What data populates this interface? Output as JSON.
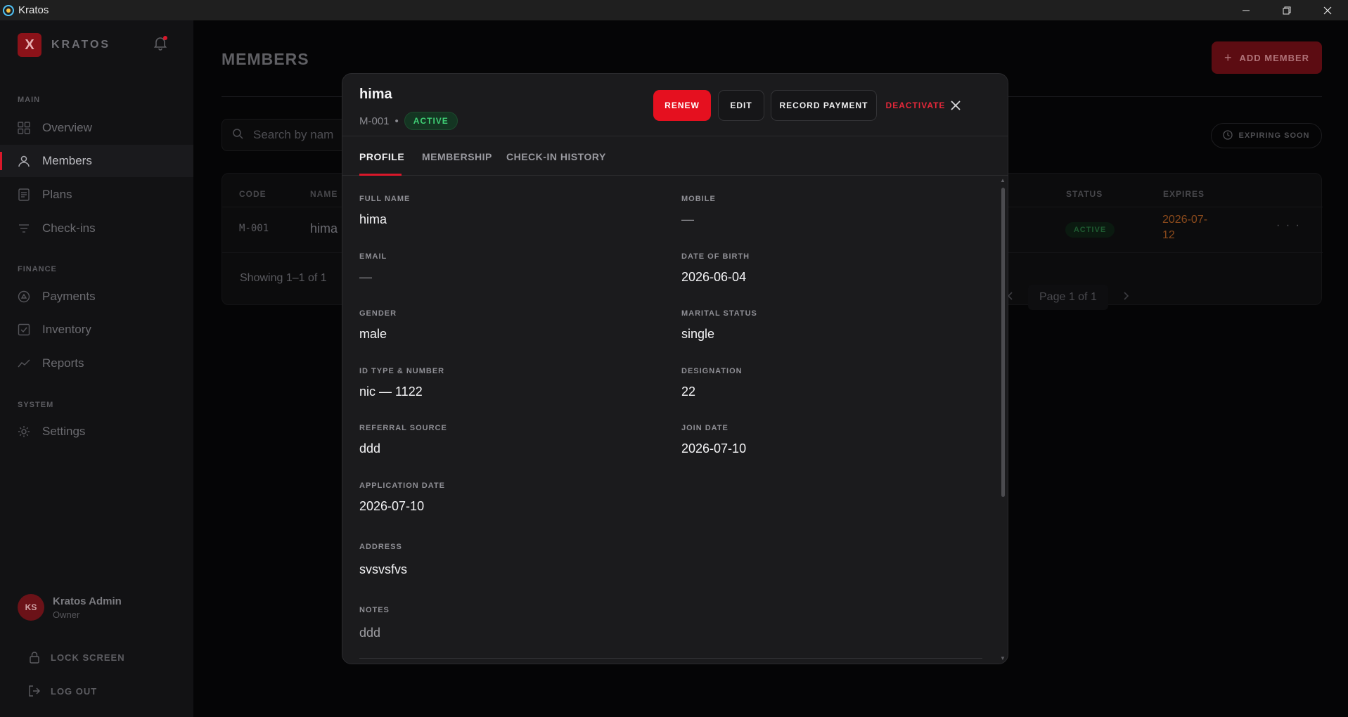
{
  "window": {
    "title": "Kratos",
    "controls": [
      "minimize",
      "restore",
      "close"
    ]
  },
  "sidebar": {
    "brand": {
      "logo_letter": "X",
      "name": "KRATOS"
    },
    "sections": [
      {
        "label": "MAIN",
        "items": [
          {
            "label": "Overview",
            "icon": "grid-icon",
            "active": false
          },
          {
            "label": "Members",
            "icon": "user-icon",
            "active": true
          },
          {
            "label": "Plans",
            "icon": "document-icon",
            "active": false
          },
          {
            "label": "Check-ins",
            "icon": "filter-icon",
            "active": false
          }
        ]
      },
      {
        "label": "FINANCE",
        "items": [
          {
            "label": "Payments",
            "icon": "coin-icon",
            "active": false
          },
          {
            "label": "Inventory",
            "icon": "checkbox-icon",
            "active": false
          },
          {
            "label": "Reports",
            "icon": "trend-icon",
            "active": false
          }
        ]
      },
      {
        "label": "SYSTEM",
        "items": [
          {
            "label": "Settings",
            "icon": "gear-icon",
            "active": false
          }
        ]
      }
    ],
    "user": {
      "initials": "KS",
      "name": "Kratos Admin",
      "role": "Owner"
    },
    "lock_label": "LOCK SCREEN",
    "logout_label": "LOG OUT"
  },
  "main": {
    "title": "MEMBERS",
    "add_button": "ADD MEMBER",
    "search_placeholder": "Search by nam",
    "expiring_filter": "EXPIRING SOON",
    "table": {
      "headers": {
        "code": "CODE",
        "name": "NAME",
        "status": "STATUS",
        "expires": "EXPIRES"
      },
      "rows": [
        {
          "code": "M-001",
          "name": "hima",
          "status": "ACTIVE",
          "expires_line1": "2026-07-",
          "expires_line2": "12",
          "menu": "· · ·"
        }
      ],
      "showing": "Showing 1–1 of 1",
      "page_label": "Page 1 of 1"
    }
  },
  "modal": {
    "name": "hima",
    "code": "M-001",
    "status": "ACTIVE",
    "actions": {
      "renew": "RENEW",
      "edit": "EDIT",
      "record_payment": "RECORD PAYMENT",
      "deactivate": "DEACTIVATE"
    },
    "tabs": [
      "PROFILE",
      "MEMBERSHIP",
      "CHECK-IN HISTORY"
    ],
    "active_tab": "PROFILE",
    "fields": {
      "full_name": {
        "label": "FULL NAME",
        "value": "hima"
      },
      "mobile": {
        "label": "MOBILE",
        "value": "—"
      },
      "email": {
        "label": "EMAIL",
        "value": "—"
      },
      "dob": {
        "label": "DATE OF BIRTH",
        "value": "2026-06-04"
      },
      "gender": {
        "label": "GENDER",
        "value": "male"
      },
      "marital": {
        "label": "MARITAL STATUS",
        "value": "single"
      },
      "id_type": {
        "label": "ID TYPE & NUMBER",
        "value": "nic — 1122"
      },
      "designation": {
        "label": "DESIGNATION",
        "value": "22"
      },
      "referral": {
        "label": "REFERRAL SOURCE",
        "value": "ddd"
      },
      "join_date": {
        "label": "JOIN DATE",
        "value": "2026-07-10"
      },
      "application_date": {
        "label": "APPLICATION DATE",
        "value": "2026-07-10"
      },
      "address": {
        "label": "ADDRESS",
        "value": "svsvsfvs"
      },
      "notes": {
        "label": "NOTES",
        "value": "ddd"
      }
    }
  },
  "colors": {
    "accent": "#e5101f",
    "active_green": "#3fcf75",
    "expires_orange": "#8a4a1c"
  }
}
